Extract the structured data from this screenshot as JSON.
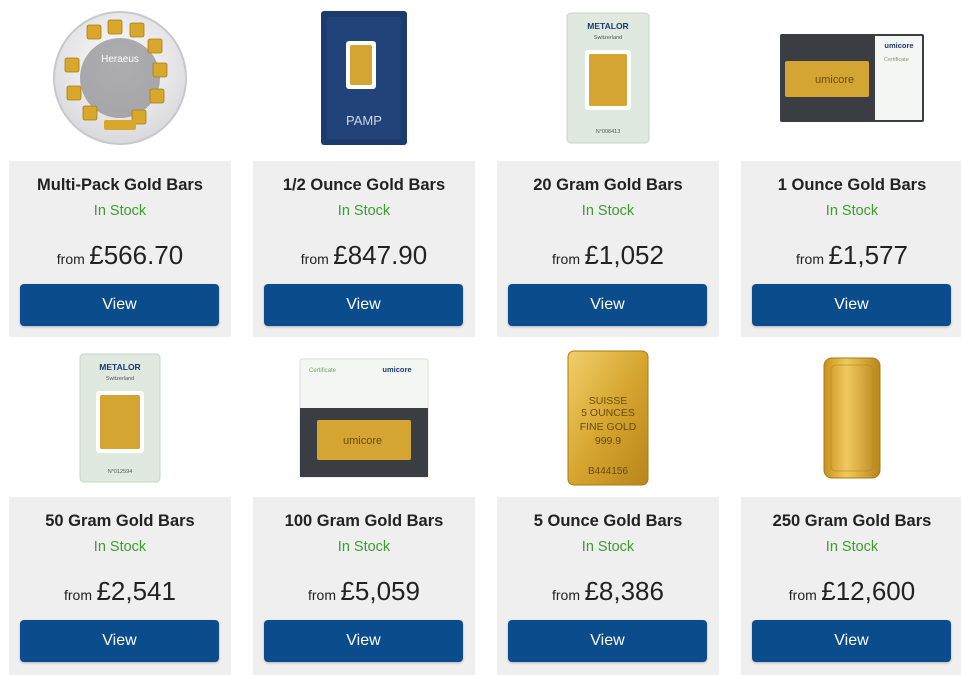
{
  "products": [
    {
      "title": "Multi-Pack Gold Bars",
      "stock": "In Stock",
      "from": "from",
      "price": "£566.70",
      "button": "View",
      "image": {
        "brand": "Heraeus",
        "label": "Heraeus"
      }
    },
    {
      "title": "1/2 Ounce Gold Bars",
      "stock": "In Stock",
      "from": "from",
      "price": "£847.90",
      "button": "View",
      "image": {
        "brand": "PAMP",
        "label": "PAMP"
      }
    },
    {
      "title": "20 Gram Gold Bars",
      "stock": "In Stock",
      "from": "from",
      "price": "£1,052",
      "button": "View",
      "image": {
        "brand": "METALOR",
        "sub": "Switzerland",
        "serial": "N°008413"
      }
    },
    {
      "title": "1 Ounce Gold Bars",
      "stock": "In Stock",
      "from": "from",
      "price": "£1,577",
      "button": "View",
      "image": {
        "brand": "umicore",
        "cert": "Certificate",
        "bar": "umicore"
      }
    },
    {
      "title": "50 Gram Gold Bars",
      "stock": "In Stock",
      "from": "from",
      "price": "£2,541",
      "button": "View",
      "image": {
        "brand": "METALOR",
        "sub": "Switzerland",
        "serial": "N°012594"
      }
    },
    {
      "title": "100 Gram Gold Bars",
      "stock": "In Stock",
      "from": "from",
      "price": "£5,059",
      "button": "View",
      "image": {
        "brand": "umicore",
        "cert": "Certificate",
        "bar": "umicore"
      }
    },
    {
      "title": "5 Ounce Gold Bars",
      "stock": "In Stock",
      "from": "from",
      "price": "£8,386",
      "button": "View",
      "image": {
        "l1": "SUISSE",
        "l2": "5 OUNCES",
        "l3": "FINE GOLD",
        "l4": "999.9",
        "serial": "B444156"
      }
    },
    {
      "title": "250 Gram Gold Bars",
      "stock": "In Stock",
      "from": "from",
      "price": "£12,600",
      "button": "View",
      "image": {
        "brand": "cast bar"
      }
    }
  ],
  "colors": {
    "button": "#0b4c8c",
    "stock": "#3a9e2e",
    "panel": "#efefef",
    "gold": "#d4a533"
  }
}
